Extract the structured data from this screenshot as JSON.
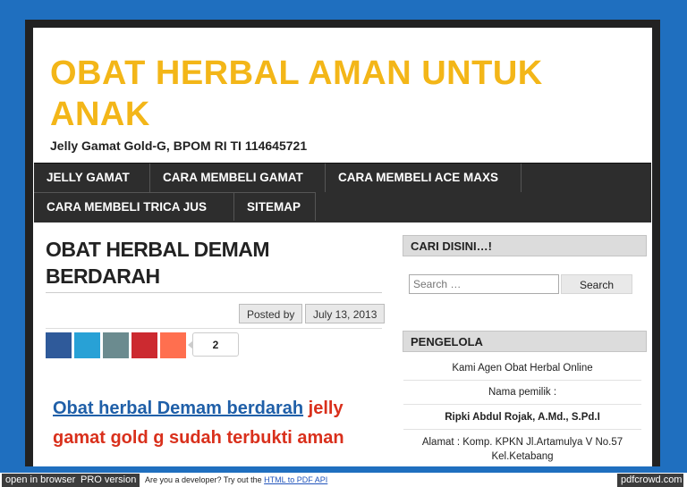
{
  "site": {
    "title": "OBAT HERBAL AMAN UNTUK ANAK",
    "tagline": "Jelly Gamat Gold-G, BPOM RI TI 114645721"
  },
  "nav": {
    "items": [
      {
        "label": "JELLY GAMAT"
      },
      {
        "label": "CARA MEMBELI GAMAT"
      },
      {
        "label": "CARA MEMBELI ACE MAXS"
      },
      {
        "label": "CARA MEMBELI TRICA JUS"
      },
      {
        "label": "SITEMAP"
      }
    ]
  },
  "post": {
    "title": "OBAT HERBAL DEMAM BERDARAH",
    "posted_by": "Posted by",
    "date": "July 13, 2013",
    "share_count": "2",
    "share_colors": [
      "#2f5a9a",
      "#28a1d6",
      "#6b8b8f",
      "#cc2a30",
      "#ff6f4f"
    ],
    "body_link": "Obat herbal Demam berdarah",
    "body_rest_1": "jelly",
    "body_line_2": "gamat gold g sudah terbukti aman"
  },
  "sidebar": {
    "search_heading": "CARI DISINI…!",
    "search_placeholder": "Search …",
    "search_button": "Search",
    "owner_heading": "PENGELOLA",
    "lines": [
      "Kami Agen Obat Herbal Online",
      "Nama pemilik :",
      "Ripki Abdul Rojak, A.Md., S.Pd.I",
      "Alamat : Komp. KPKN Jl.Artamulya V No.57",
      "Kel.Ketabang"
    ]
  },
  "pdfbar": {
    "open_in_browser": "open in browser",
    "pro_version": "PRO version",
    "developer_text": "Are you a developer? Try out the",
    "api_link": "HTML to PDF API",
    "brand": "pdfcrowd.com"
  }
}
